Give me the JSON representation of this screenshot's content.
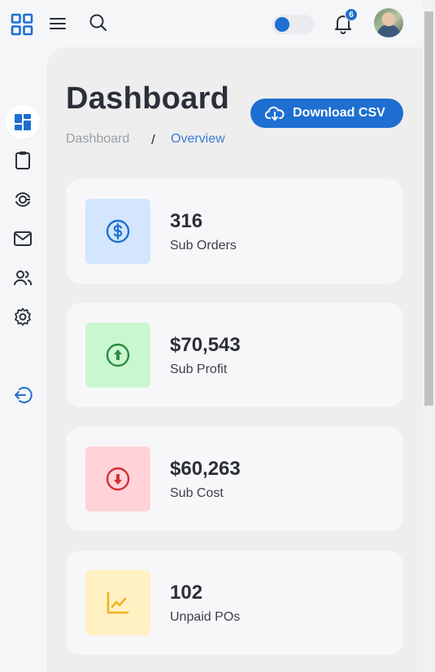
{
  "header": {
    "notification_count": "6",
    "theme_toggle_on": true,
    "icons": [
      "grid-icon",
      "menu-icon",
      "search-icon",
      "bell-icon",
      "avatar"
    ]
  },
  "sidebar": {
    "items": [
      {
        "icon": "dashboard-icon",
        "active": true
      },
      {
        "icon": "clipboard-icon",
        "active": false
      },
      {
        "icon": "analytics-icon",
        "active": false
      },
      {
        "icon": "mail-icon",
        "active": false
      },
      {
        "icon": "users-icon",
        "active": false
      },
      {
        "icon": "settings-icon",
        "active": false
      },
      {
        "icon": "logout-icon",
        "active": false
      }
    ]
  },
  "page": {
    "title": "Dashboard",
    "download_label": "Download CSV",
    "breadcrumb": {
      "first": "Dashboard",
      "separator": "/",
      "current": "Overview"
    }
  },
  "cards": [
    {
      "value": "316",
      "label": "Sub Orders",
      "icon": "dollar-icon"
    },
    {
      "value": "$70,543",
      "label": "Sub Profit",
      "icon": "arrow-up-icon"
    },
    {
      "value": "$60,263",
      "label": "Sub Cost",
      "icon": "arrow-down-icon"
    },
    {
      "value": "102",
      "label": "Unpaid POs",
      "icon": "chart-icon"
    }
  ],
  "colors": {
    "accent": "#1e6fd1",
    "card_blue": "#d3e6fd",
    "card_green": "#c9f7d0",
    "card_red": "#ffd3d8",
    "card_yellow": "#fff1c2"
  }
}
